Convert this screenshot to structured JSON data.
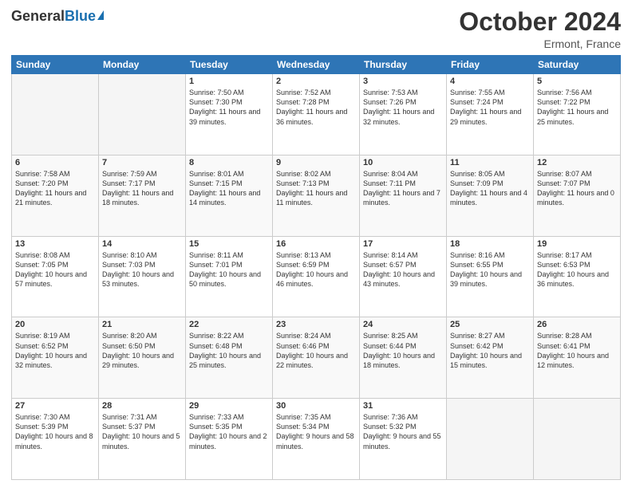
{
  "header": {
    "logo_general": "General",
    "logo_blue": "Blue",
    "month": "October 2024",
    "location": "Ermont, France"
  },
  "days_of_week": [
    "Sunday",
    "Monday",
    "Tuesday",
    "Wednesday",
    "Thursday",
    "Friday",
    "Saturday"
  ],
  "weeks": [
    {
      "cells": [
        {
          "day": "",
          "empty": true
        },
        {
          "day": "",
          "empty": true
        },
        {
          "day": "1",
          "sunrise": "7:50 AM",
          "sunset": "7:30 PM",
          "daylight": "11 hours and 39 minutes."
        },
        {
          "day": "2",
          "sunrise": "7:52 AM",
          "sunset": "7:28 PM",
          "daylight": "11 hours and 36 minutes."
        },
        {
          "day": "3",
          "sunrise": "7:53 AM",
          "sunset": "7:26 PM",
          "daylight": "11 hours and 32 minutes."
        },
        {
          "day": "4",
          "sunrise": "7:55 AM",
          "sunset": "7:24 PM",
          "daylight": "11 hours and 29 minutes."
        },
        {
          "day": "5",
          "sunrise": "7:56 AM",
          "sunset": "7:22 PM",
          "daylight": "11 hours and 25 minutes."
        }
      ]
    },
    {
      "cells": [
        {
          "day": "6",
          "sunrise": "7:58 AM",
          "sunset": "7:20 PM",
          "daylight": "11 hours and 21 minutes."
        },
        {
          "day": "7",
          "sunrise": "7:59 AM",
          "sunset": "7:17 PM",
          "daylight": "11 hours and 18 minutes."
        },
        {
          "day": "8",
          "sunrise": "8:01 AM",
          "sunset": "7:15 PM",
          "daylight": "11 hours and 14 minutes."
        },
        {
          "day": "9",
          "sunrise": "8:02 AM",
          "sunset": "7:13 PM",
          "daylight": "11 hours and 11 minutes."
        },
        {
          "day": "10",
          "sunrise": "8:04 AM",
          "sunset": "7:11 PM",
          "daylight": "11 hours and 7 minutes."
        },
        {
          "day": "11",
          "sunrise": "8:05 AM",
          "sunset": "7:09 PM",
          "daylight": "11 hours and 4 minutes."
        },
        {
          "day": "12",
          "sunrise": "8:07 AM",
          "sunset": "7:07 PM",
          "daylight": "11 hours and 0 minutes."
        }
      ]
    },
    {
      "cells": [
        {
          "day": "13",
          "sunrise": "8:08 AM",
          "sunset": "7:05 PM",
          "daylight": "10 hours and 57 minutes."
        },
        {
          "day": "14",
          "sunrise": "8:10 AM",
          "sunset": "7:03 PM",
          "daylight": "10 hours and 53 minutes."
        },
        {
          "day": "15",
          "sunrise": "8:11 AM",
          "sunset": "7:01 PM",
          "daylight": "10 hours and 50 minutes."
        },
        {
          "day": "16",
          "sunrise": "8:13 AM",
          "sunset": "6:59 PM",
          "daylight": "10 hours and 46 minutes."
        },
        {
          "day": "17",
          "sunrise": "8:14 AM",
          "sunset": "6:57 PM",
          "daylight": "10 hours and 43 minutes."
        },
        {
          "day": "18",
          "sunrise": "8:16 AM",
          "sunset": "6:55 PM",
          "daylight": "10 hours and 39 minutes."
        },
        {
          "day": "19",
          "sunrise": "8:17 AM",
          "sunset": "6:53 PM",
          "daylight": "10 hours and 36 minutes."
        }
      ]
    },
    {
      "cells": [
        {
          "day": "20",
          "sunrise": "8:19 AM",
          "sunset": "6:52 PM",
          "daylight": "10 hours and 32 minutes."
        },
        {
          "day": "21",
          "sunrise": "8:20 AM",
          "sunset": "6:50 PM",
          "daylight": "10 hours and 29 minutes."
        },
        {
          "day": "22",
          "sunrise": "8:22 AM",
          "sunset": "6:48 PM",
          "daylight": "10 hours and 25 minutes."
        },
        {
          "day": "23",
          "sunrise": "8:24 AM",
          "sunset": "6:46 PM",
          "daylight": "10 hours and 22 minutes."
        },
        {
          "day": "24",
          "sunrise": "8:25 AM",
          "sunset": "6:44 PM",
          "daylight": "10 hours and 18 minutes."
        },
        {
          "day": "25",
          "sunrise": "8:27 AM",
          "sunset": "6:42 PM",
          "daylight": "10 hours and 15 minutes."
        },
        {
          "day": "26",
          "sunrise": "8:28 AM",
          "sunset": "6:41 PM",
          "daylight": "10 hours and 12 minutes."
        }
      ]
    },
    {
      "cells": [
        {
          "day": "27",
          "sunrise": "7:30 AM",
          "sunset": "5:39 PM",
          "daylight": "10 hours and 8 minutes."
        },
        {
          "day": "28",
          "sunrise": "7:31 AM",
          "sunset": "5:37 PM",
          "daylight": "10 hours and 5 minutes."
        },
        {
          "day": "29",
          "sunrise": "7:33 AM",
          "sunset": "5:35 PM",
          "daylight": "10 hours and 2 minutes."
        },
        {
          "day": "30",
          "sunrise": "7:35 AM",
          "sunset": "5:34 PM",
          "daylight": "9 hours and 58 minutes."
        },
        {
          "day": "31",
          "sunrise": "7:36 AM",
          "sunset": "5:32 PM",
          "daylight": "9 hours and 55 minutes."
        },
        {
          "day": "",
          "empty": true
        },
        {
          "day": "",
          "empty": true
        }
      ]
    }
  ]
}
